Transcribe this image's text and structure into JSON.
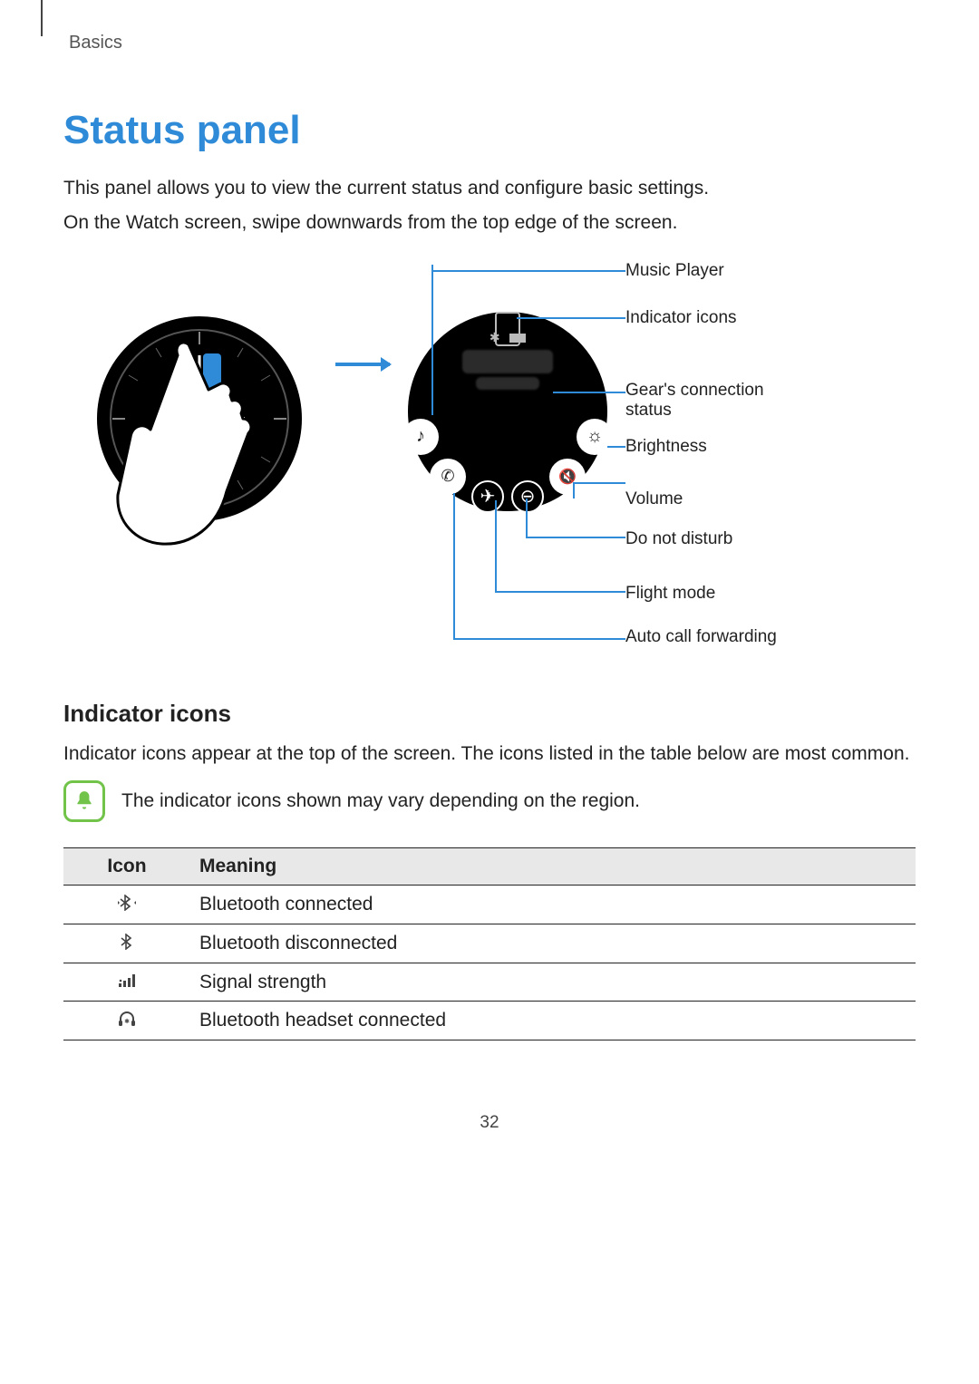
{
  "breadcrumb": "Basics",
  "title": "Status panel",
  "intro1": "This panel allows you to view the current status and configure basic settings.",
  "intro2": "On the Watch screen, swipe downwards from the top edge of the screen.",
  "callouts": {
    "music": "Music Player",
    "indicators": "Indicator icons",
    "connection": "Gear's connection status",
    "brightness": "Brightness",
    "volume": "Volume",
    "dnd": "Do not disturb",
    "flight": "Flight mode",
    "forwarding": "Auto call forwarding"
  },
  "sub_heading": "Indicator icons",
  "sub_intro": "Indicator icons appear at the top of the screen. The icons listed in the table below are most common.",
  "note": "The indicator icons shown may vary depending on the region.",
  "table": {
    "head_icon": "Icon",
    "head_meaning": "Meaning",
    "rows": [
      {
        "meaning": "Bluetooth connected"
      },
      {
        "meaning": "Bluetooth disconnected"
      },
      {
        "meaning": "Signal strength"
      },
      {
        "meaning": "Bluetooth headset connected"
      }
    ]
  },
  "page_number": "32"
}
